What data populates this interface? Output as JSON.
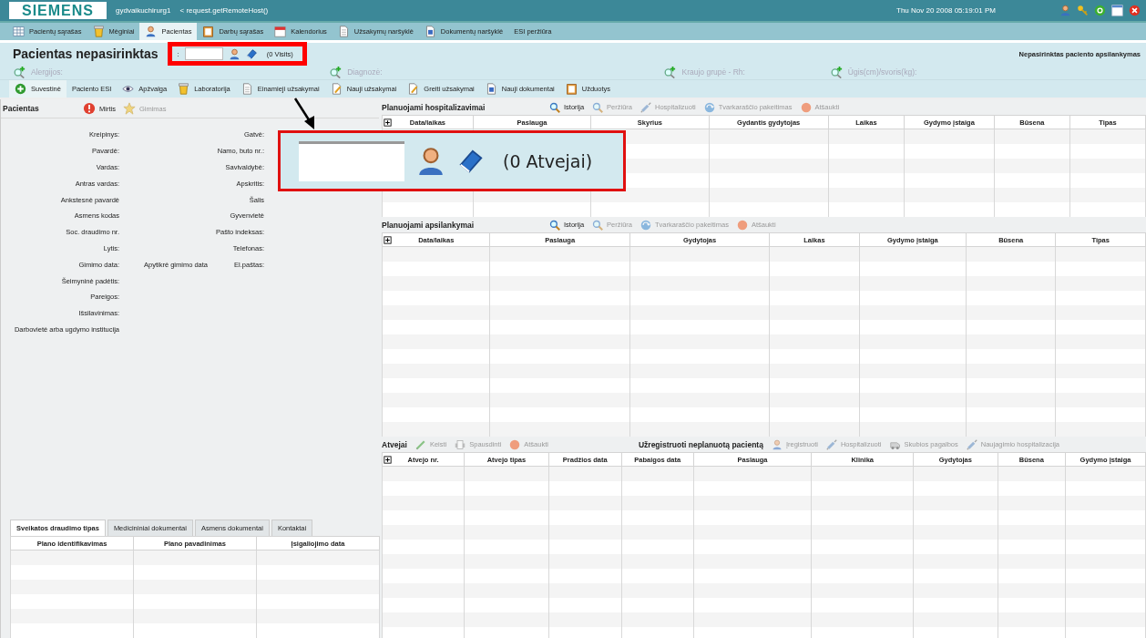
{
  "top_bar": {
    "logo": "SIEMENS",
    "user": "gydvaikuchirurg1",
    "host": "< request.getRemoteHost()",
    "datetime": "Thu Nov 20 2008 05:19:01 PM"
  },
  "main_tabs": [
    {
      "label": "Pacientų sąrašas",
      "kind": "grid",
      "selected": false
    },
    {
      "label": "Mėginiai",
      "kind": "jar",
      "selected": false
    },
    {
      "label": "Pacientas",
      "kind": "person",
      "selected": true
    },
    {
      "label": "Darbų sąrašas",
      "kind": "clipboard",
      "selected": false
    },
    {
      "label": "Kalendorius",
      "kind": "calendar",
      "selected": false
    },
    {
      "label": "Užsakymų naršyklė",
      "kind": "document",
      "selected": false
    },
    {
      "label": "Dokumentų naršyklė",
      "kind": "document-blue",
      "selected": false
    },
    {
      "label": "ESI peržiūra",
      "kind": "none",
      "selected": false
    }
  ],
  "patient_header": {
    "title": "Pacientas nepasirinktas",
    "separator": ":",
    "visits": "(0 Visits)",
    "visit_status": "Nepasirinktas paciento apsilankymas"
  },
  "info_fields": [
    {
      "label": "Alergijos:",
      "disabled": true
    },
    {
      "label": "Diagnozė:",
      "disabled": true
    },
    {
      "label": "Kraujo grupė - Rh:",
      "disabled": true
    },
    {
      "label": "Ūgis(cm)/svoris(kg):",
      "disabled": true
    }
  ],
  "nav_tabs": [
    {
      "label": "Suvestinė",
      "kind": "plus",
      "selected": true
    },
    {
      "label": "Paciento ESI",
      "kind": "none",
      "selected": false
    },
    {
      "label": "Apžvalga",
      "kind": "eye",
      "selected": false
    },
    {
      "label": "Laboratorija",
      "kind": "jar",
      "selected": false
    },
    {
      "label": "Einamieji užsakymai",
      "kind": "document",
      "selected": false
    },
    {
      "label": "Nauji užsakymai",
      "kind": "edit-document",
      "selected": false
    },
    {
      "label": "Greiti užsakymai",
      "kind": "edit-document",
      "selected": false
    },
    {
      "label": "Nauji dokumentai",
      "kind": "document-blue",
      "selected": false
    },
    {
      "label": "Užduotys",
      "kind": "clipboard",
      "selected": false
    }
  ],
  "patient_panel": {
    "title": "Pacientas",
    "actions": [
      {
        "label": "Mirtis",
        "kind": "alert",
        "disabled": false
      },
      {
        "label": "Gimimas",
        "kind": "star",
        "disabled": true
      }
    ],
    "form_rows": [
      {
        "label": "Kreipinys:",
        "right_label": "Gatvė:"
      },
      {
        "label": "Pavardė:",
        "right_label": "Namo, buto nr.:"
      },
      {
        "label": "Vardas:",
        "right_label": "Savivaldybė:"
      },
      {
        "label": "Antras vardas:",
        "right_label": "Apskritis:"
      },
      {
        "label": "Ankstesnė pavardė",
        "right_label": "Šalis"
      },
      {
        "label": "Asmens kodas",
        "right_label": "Gyvenvietė"
      },
      {
        "label": "Soc. draudimo nr.",
        "right_label": "Pašto indeksas:"
      },
      {
        "label": "Lytis:",
        "right_label": "Telefonas:"
      },
      {
        "label": "Gimimo data:",
        "note": "Apytikrė gimimo data",
        "right_label": "El.paštas:"
      },
      {
        "label": "Šeimyninė padėtis:"
      },
      {
        "label": "Pareigos:"
      },
      {
        "label": "Išsilavinimas:"
      },
      {
        "label": "Darbovietė arba ugdymo institucija"
      }
    ]
  },
  "bottom_tabs": [
    {
      "label": "Sveikatos draudimo tipas",
      "selected": true
    },
    {
      "label": "Medicininiai dokumentai",
      "selected": false
    },
    {
      "label": "Asmens dokumentai",
      "selected": false
    },
    {
      "label": "Kontaktai",
      "selected": false
    }
  ],
  "bottom_table": {
    "columns": [
      "Plano identifikavimas",
      "Plano pavadinimas",
      "Įsigaliojimo data"
    ]
  },
  "hospitalizations": {
    "title": "Planuojami hospitalizavimai",
    "actions": [
      {
        "label": "Istorija",
        "kind": "search",
        "disabled": false
      },
      {
        "label": "Peržiūra",
        "kind": "search",
        "disabled": true
      },
      {
        "label": "Hospitalizuoti",
        "kind": "syringe",
        "disabled": true
      },
      {
        "label": "Tvarkaraščio pakeitimas",
        "kind": "refresh",
        "disabled": true
      },
      {
        "label": "Atšaukti",
        "kind": "cancel",
        "disabled": true
      }
    ],
    "columns": [
      "Data/laikas",
      "Paslauga",
      "Skyrius",
      "Gydantis gydytojas",
      "Laikas",
      "Gydymo įstaiga",
      "Būsena",
      "Tipas"
    ]
  },
  "visits": {
    "title": "Planuojami apsilankymai",
    "actions": [
      {
        "label": "Istorija",
        "kind": "search",
        "disabled": false
      },
      {
        "label": "Peržiūra",
        "kind": "search",
        "disabled": true
      },
      {
        "label": "Tvarkaraščio pakeitimas",
        "kind": "refresh",
        "disabled": true
      },
      {
        "label": "Atšaukti",
        "kind": "cancel",
        "disabled": true
      }
    ],
    "columns": [
      "Data/laikas",
      "Paslauga",
      "Gydytojas",
      "Laikas",
      "Gydymo įstaiga",
      "Būsena",
      "Tipas"
    ]
  },
  "cases": {
    "title": "Atvejai",
    "actions": [
      {
        "label": "Keisti",
        "kind": "pencil",
        "disabled": true
      },
      {
        "label": "Spausdinti",
        "kind": "printer",
        "disabled": true
      },
      {
        "label": "Atšaukti",
        "kind": "cancel",
        "disabled": true
      }
    ],
    "register_title": "Užregistruoti neplanuotą pacientą",
    "register_actions": [
      {
        "label": "Įregistruoti",
        "kind": "person",
        "disabled": true
      },
      {
        "label": "Hospitalizuoti",
        "kind": "syringe",
        "disabled": true
      },
      {
        "label": "Skubios pagalbos",
        "kind": "vehicle",
        "disabled": true
      },
      {
        "label": "Naujagimio hospitalizacija",
        "kind": "syringe",
        "disabled": true
      }
    ],
    "columns": [
      "Atvejo nr.",
      "Atvejo tipas",
      "Pradžios data",
      "Pabaigos data",
      "Paslauga",
      "Klinika",
      "Gydytojas",
      "Būsena",
      "Gydymo įstaiga"
    ]
  },
  "callout": {
    "text": "(0 Atvejai)"
  }
}
